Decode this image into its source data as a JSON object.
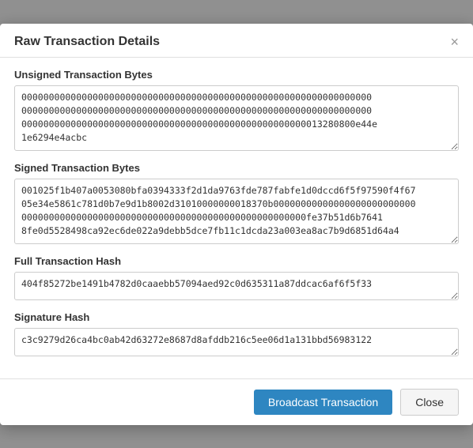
{
  "modal": {
    "title": "Raw Transaction Details",
    "close_label": "×"
  },
  "sections": {
    "unsigned_label": "Unsigned Transaction Bytes",
    "unsigned_value": "0000000000000000000000000000000000000000000000000000000000000000\n0000000000000000000000000000000000000000000000000000000000000000\n0000000000000000000000000000000000000000000000000000013280800e44e\n1e6294e4acbc",
    "signed_label": "Signed Transaction Bytes",
    "signed_value": "001025f1b407a0053080bfa0394333f2d1da9763fde787fabfe1d0dccd6f5f97590f4f67\n05e34e5861c781d0b7e9d1b8002d31010000000018370b00000000000000000000000000\n0000000000000000000000000000000000000000000000000000fe37b51d6b7641\n8fe0d5528498ca92ec6de022a9debb5dce7fb11c1dcda23a003ea8ac7b9d6851d64a4",
    "full_hash_label": "Full Transaction Hash",
    "full_hash_value": "404f85272be1491b4782d0caaebb57094aed92c0d635311a87ddcac6af6f5f33",
    "sig_hash_label": "Signature Hash",
    "sig_hash_value": "c3c9279d26ca4bc0ab42d63272e8687d8afddb216c5ee06d1a131bbd56983122"
  },
  "footer": {
    "broadcast_label": "Broadcast Transaction",
    "close_label": "Close"
  }
}
